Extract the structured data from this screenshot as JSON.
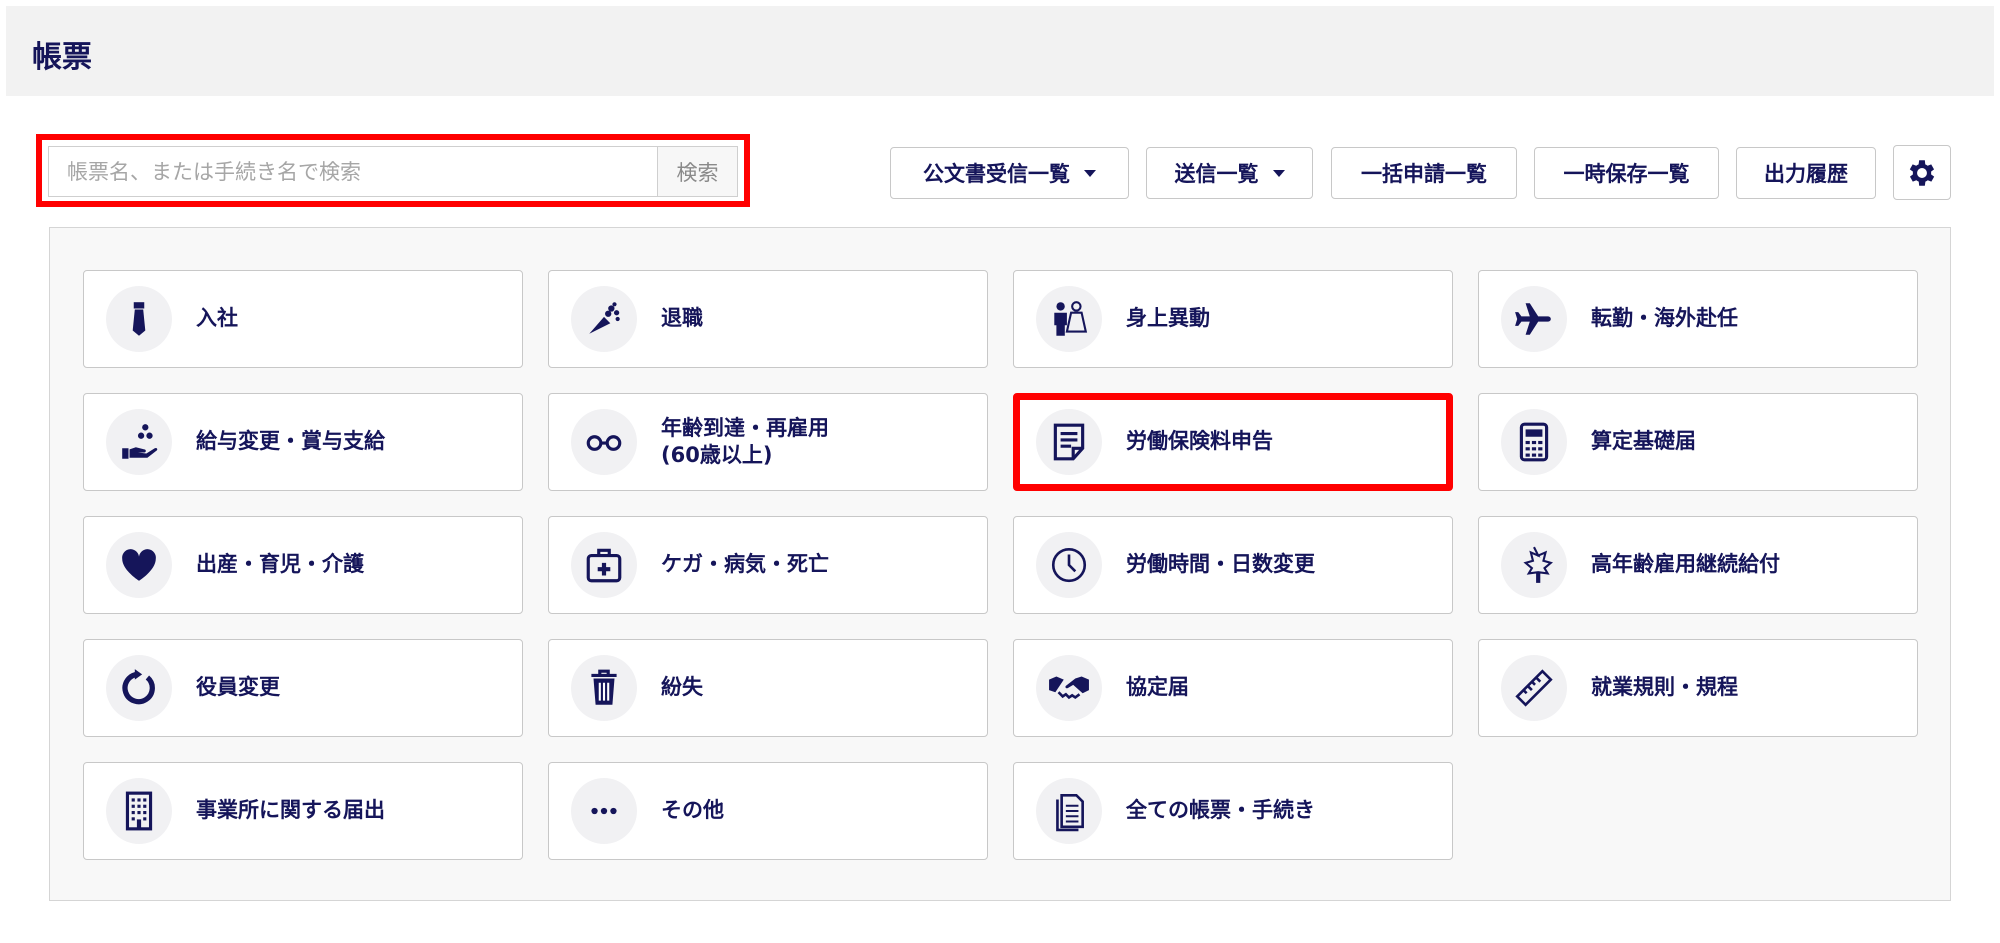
{
  "header": {
    "title": "帳票"
  },
  "search": {
    "placeholder": "帳票名、または手続き名で検索",
    "button_label": "検索"
  },
  "toolbar": {
    "public_docs_label": "公文書受信一覧",
    "sent_list_label": "送信一覧",
    "bulk_apply_label": "一括申請一覧",
    "temp_saved_label": "一時保存一覧",
    "output_history_label": "出力履歴",
    "settings_icon": "gear-icon"
  },
  "cards": [
    {
      "label": "入社",
      "icon": "necktie-icon"
    },
    {
      "label": "退職",
      "icon": "bouquet-icon"
    },
    {
      "label": "身上異動",
      "icon": "wedding-couple-icon"
    },
    {
      "label": "転勤・海外赴任",
      "icon": "airplane-icon"
    },
    {
      "label": "給与変更・賞与支給",
      "icon": "hand-coins-icon"
    },
    {
      "label": "年齢到達・再雇用",
      "label2": "(60歳以上)",
      "icon": "glasses-icon"
    },
    {
      "label": "労働保険料申告",
      "icon": "document-icon",
      "highlighted": true
    },
    {
      "label": "算定基礎届",
      "icon": "calculator-icon"
    },
    {
      "label": "出産・育児・介護",
      "icon": "heart-icon"
    },
    {
      "label": "ケガ・病気・死亡",
      "icon": "first-aid-kit-icon"
    },
    {
      "label": "労働時間・日数変更",
      "icon": "clock-icon"
    },
    {
      "label": "高年齢雇用継続給付",
      "icon": "maple-leaf-icon"
    },
    {
      "label": "役員変更",
      "icon": "refresh-icon"
    },
    {
      "label": "紛失",
      "icon": "trash-icon"
    },
    {
      "label": "協定届",
      "icon": "handshake-icon"
    },
    {
      "label": "就業規則・規程",
      "icon": "ruler-icon"
    },
    {
      "label": "事業所に関する届出",
      "icon": "building-icon"
    },
    {
      "label": "その他",
      "icon": "more-dots-icon"
    },
    {
      "label": "全ての帳票・手続き",
      "icon": "documents-icon"
    }
  ],
  "colors": {
    "navy": "#15155a",
    "highlight": "#ff0000"
  }
}
